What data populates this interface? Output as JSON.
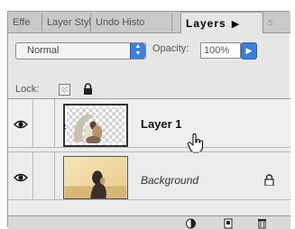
{
  "tabs": {
    "effects": "Effe",
    "layer_styles": "Layer Styl",
    "undo_history": "Undo Histo",
    "layers": "Layers",
    "extra": "s",
    "menu_arrow": "▶"
  },
  "blend": {
    "mode": "Normal",
    "opacity_label": "Opacity:",
    "opacity_value": "100%"
  },
  "lock": {
    "label": "Lock:"
  },
  "layers": [
    {
      "name": "Layer 1",
      "visible": true,
      "selected": true
    },
    {
      "name": "Background",
      "visible": true,
      "locked": true
    }
  ],
  "icons": {
    "eye": "eye-icon",
    "brush": "brush-icon",
    "lock": "lock-icon",
    "cursor": "hand-cursor-icon",
    "new_layer": "new-layer-icon",
    "trash": "trash-icon",
    "adjustment": "adjustment-layer-icon"
  },
  "colors": {
    "accent": "#3f7fd6",
    "panel": "#e6e6e6"
  }
}
